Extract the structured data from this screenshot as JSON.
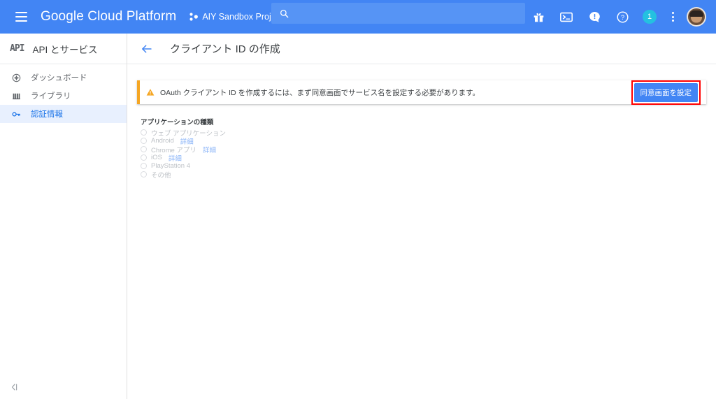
{
  "topbar": {
    "menu_icon": "hamburger-icon",
    "brand": "Google Cloud Platform",
    "project_name": "AIY Sandbox Project",
    "project_icon": "project-dots-icon",
    "search": {
      "value": "",
      "placeholder": "",
      "icon": "search-icon"
    },
    "icons": [
      {
        "name": "gift-icon",
        "label": ""
      },
      {
        "name": "cloud-shell-icon",
        "label": ""
      },
      {
        "name": "notifications-icon",
        "label": ""
      },
      {
        "name": "help-icon",
        "label": ""
      }
    ],
    "badge_count": "1",
    "badge_color": "#24C1E0",
    "kebab_icon": "more-vert-icon",
    "avatar": "user-avatar",
    "bar_color": "#4285F4"
  },
  "sidebar": {
    "logo_text": "API",
    "title": "API とサービス",
    "items": [
      {
        "label": "ダッシュボード",
        "icon": "dashboard-icon",
        "selected": false
      },
      {
        "label": "ライブラリ",
        "icon": "library-icon",
        "selected": false
      },
      {
        "label": "認証情報",
        "icon": "key-icon",
        "selected": true
      }
    ],
    "collapse_icon": "collapse-sidebar-icon",
    "selected_bg": "#E8F0FE",
    "selected_fg": "#1a73e8"
  },
  "page": {
    "back_icon": "back-arrow-icon",
    "title": "クライアント ID の作成"
  },
  "warning": {
    "icon": "warning-triangle-icon",
    "message": "OAuth クライアント ID を作成するには、まず同意画面でサービス名を設定する必要があります。",
    "button_label": "同意画面を設定",
    "stripe_color": "#F5A623",
    "button_color": "#4285F4",
    "highlight_color": "#FF0000"
  },
  "app_type": {
    "legend": "アプリケーションの種類",
    "options": [
      {
        "label": "ウェブ アプリケーション",
        "detail": "",
        "selected": false,
        "disabled": true
      },
      {
        "label": "Android",
        "detail": "詳細",
        "selected": false,
        "disabled": true
      },
      {
        "label": "Chrome アプリ",
        "detail": "詳細",
        "selected": false,
        "disabled": true
      },
      {
        "label": "iOS",
        "detail": "詳細",
        "selected": false,
        "disabled": true
      },
      {
        "label": "PlayStation 4",
        "detail": "",
        "selected": false,
        "disabled": true
      },
      {
        "label": "その他",
        "detail": "",
        "selected": false,
        "disabled": true
      }
    ],
    "link_color": "#8ab4f8"
  }
}
